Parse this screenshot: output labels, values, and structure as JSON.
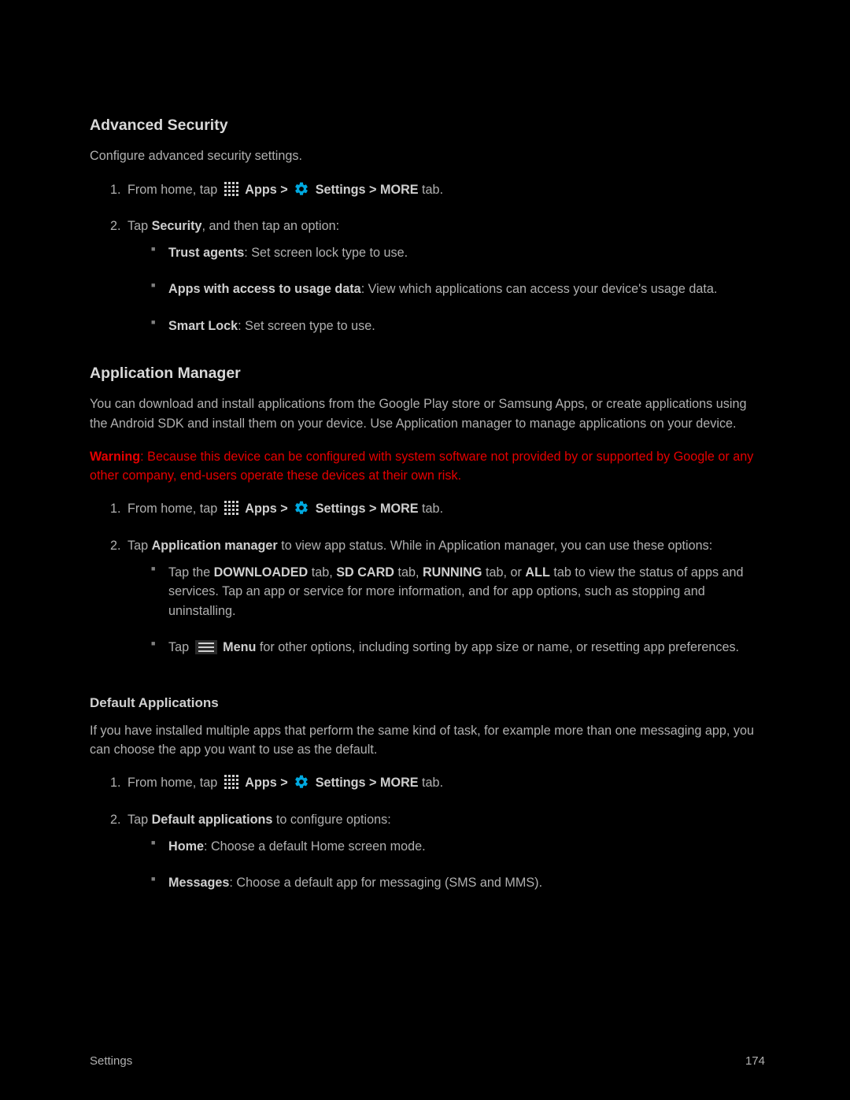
{
  "section1": {
    "heading": "Advanced Security",
    "intro": "Configure advanced security settings.",
    "li1_a": "From home, tap ",
    "apps_b": "Apps > ",
    "settings_b": "Settings > MORE",
    "tab_txt": " tab.",
    "li2_a": "Tap ",
    "li2_b": "Security",
    "li2_c": ", and then tap an option:",
    "b1_t": "Trust agents",
    "b1_r": ": Set screen lock type to use.",
    "b2_t": "Apps with access to usage data",
    "b2_r": ": View which applications can access your device's usage data.",
    "b3_t": "Smart Lock",
    "b3_r": ": Set screen type to use."
  },
  "section2": {
    "heading": "Application Manager",
    "intro": "You can download and install applications from the Google Play store or Samsung Apps, or create applications using the Android SDK and install them on your device. Use Application manager to manage applications on your device.",
    "warn_t": "Warning",
    "warn_r": ": Because this device can be configured with system software not provided by or supported by Google or any other company, end-users operate these devices at their own risk.",
    "li2_a": "Tap ",
    "li2_b": "Application manager",
    "li2_c": " to view app status. While in Application manager, you can use these options:",
    "b1_a": "Tap the ",
    "b1_b1": "DOWNLOADED",
    "b1_m1": " tab, ",
    "b1_b2": "SD CARD",
    "b1_m2": " tab, ",
    "b1_b3": "RUNNING",
    "b1_m3": " tab, or ",
    "b1_b4": "ALL",
    "b1_r": " tab to view the status of apps and services. Tap an app or service for more information, and for app options, such as stopping and uninstalling.",
    "b2_a": "Tap ",
    "b2_b": "Menu",
    "b2_r": " for other options, including sorting by app size or name, or resetting app preferences."
  },
  "section3": {
    "heading": "Default Applications",
    "intro": "If you have installed multiple apps that perform the same kind of task, for example more than one messaging app, you can choose the app you want to use as the default.",
    "li2_a": "Tap ",
    "li2_b": "Default applications",
    "li2_c": " to configure options:",
    "b1_t": "Home",
    "b1_r": ": Choose a default Home screen mode.",
    "b2_t": "Messages",
    "b2_r": ": Choose a default app for messaging (SMS and MMS)."
  },
  "footer": {
    "left": "Settings",
    "right": "174"
  }
}
